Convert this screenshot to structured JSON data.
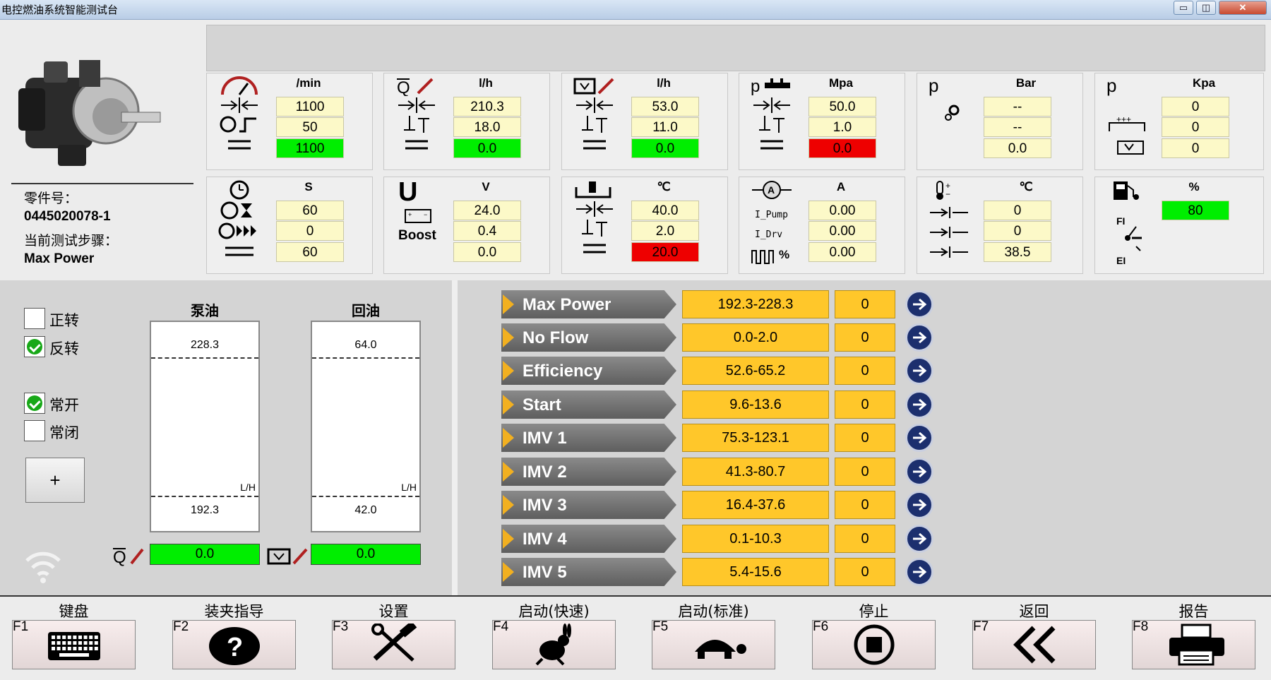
{
  "app": {
    "title": "电控燃油系统智能测试台"
  },
  "window_buttons": {
    "minimize": "▭",
    "restore": "◫",
    "close": "✕"
  },
  "cards_row1": [
    {
      "unit": "/min",
      "values": [
        "1100",
        "50",
        "1100"
      ],
      "icons": [
        "tachometer-icon",
        "setpoint-icon",
        "tolerance-icon",
        "actual-icon"
      ]
    },
    {
      "unit": "l/h",
      "values": [
        "210.3",
        "18.0",
        "0.0"
      ],
      "icons": [
        "flow-q-icon",
        "setpoint-icon",
        "tolerance-icon",
        "actual-icon"
      ]
    },
    {
      "unit": "l/h",
      "values": [
        "53.0",
        "11.0",
        "0.0"
      ],
      "icons": [
        "return-flow-icon",
        "setpoint-icon",
        "tolerance-icon",
        "actual-icon"
      ]
    },
    {
      "unit": "Mpa",
      "values": [
        "50.0",
        "1.0",
        "0.0"
      ],
      "icons": [
        "rail-pressure-icon",
        "setpoint-icon",
        "tolerance-icon",
        "actual-icon"
      ]
    },
    {
      "unit": "Bar",
      "values": [
        "--",
        "--",
        "0.0"
      ],
      "label": "p",
      "icons": [
        "gear-pressure-icon"
      ]
    },
    {
      "unit": "Kpa",
      "values": [
        "0",
        "0",
        "0"
      ],
      "label": "p",
      "icons": [
        "feed-pressure-icon",
        "return-pressure-icon"
      ]
    }
  ],
  "cards_row2": [
    {
      "unit": "S",
      "values": [
        "60",
        "0",
        "60"
      ],
      "icons": [
        "clock-icon",
        "hourglass-clock-icon",
        "fast-clock-icon",
        "total-icon"
      ]
    },
    {
      "unit": "V",
      "values": [
        "24.0",
        "0.4",
        "0.0"
      ],
      "label": "U",
      "sub": "Boost",
      "icons": [
        "battery-icon"
      ]
    },
    {
      "unit": "℃",
      "values": [
        "40.0",
        "2.0",
        "20.0"
      ],
      "icons": [
        "oil-temp-icon",
        "setpoint-icon",
        "tolerance-icon",
        "actual-icon"
      ]
    },
    {
      "unit": "A",
      "values": [
        "0.00",
        "0.00",
        "0.00"
      ],
      "labels": [
        "I_Pump",
        "I_Drv",
        "%"
      ],
      "icons": [
        "ammeter-icon",
        "pwm-icon"
      ]
    },
    {
      "unit": "℃",
      "values": [
        "0",
        "0",
        "38.5"
      ],
      "icons": [
        "thermometer-icon"
      ]
    },
    {
      "unit": "%",
      "values": [
        "80"
      ],
      "labels": [
        "FI",
        "EI"
      ],
      "icons": [
        "fuel-pump-icon",
        "switch-icon"
      ]
    }
  ],
  "part": {
    "label": "零件号：",
    "number": "0445020078-1",
    "step_label": "当前测试步骤：",
    "step": "Max Power"
  },
  "rotation": {
    "forward": "正转",
    "reverse": "反转",
    "forward_checked": false,
    "reverse_checked": true
  },
  "valve": {
    "normally_open": "常开",
    "normally_closed": "常闭",
    "open_checked": true,
    "closed_checked": false
  },
  "plus_button": "+",
  "columns": {
    "pump": {
      "title": "泵油",
      "upper": "228.3",
      "lower": "192.3",
      "unit": "L/H",
      "actual": "0.0"
    },
    "return": {
      "title": "回油",
      "upper": "64.0",
      "lower": "42.0",
      "unit": "L/H",
      "actual": "0.0"
    }
  },
  "steps": [
    {
      "name": "Max Power",
      "range": "192.3-228.3",
      "count": "0"
    },
    {
      "name": "No Flow",
      "range": "0.0-2.0",
      "count": "0"
    },
    {
      "name": "Efficiency",
      "range": "52.6-65.2",
      "count": "0"
    },
    {
      "name": "Start",
      "range": "9.6-13.6",
      "count": "0"
    },
    {
      "name": "IMV 1",
      "range": "75.3-123.1",
      "count": "0"
    },
    {
      "name": "IMV 2",
      "range": "41.3-80.7",
      "count": "0"
    },
    {
      "name": "IMV 3",
      "range": "16.4-37.6",
      "count": "0"
    },
    {
      "name": "IMV 4",
      "range": "0.1-10.3",
      "count": "0"
    },
    {
      "name": "IMV 5",
      "range": "5.4-15.6",
      "count": "0"
    }
  ],
  "fkeys": [
    {
      "key": "F1",
      "name": "键盘",
      "icon": "keyboard-icon"
    },
    {
      "key": "F2",
      "name": "装夹指导",
      "icon": "help-icon"
    },
    {
      "key": "F3",
      "name": "设置",
      "icon": "tools-icon"
    },
    {
      "key": "F4",
      "name": "启动(快速)",
      "icon": "rabbit-icon"
    },
    {
      "key": "F5",
      "name": "启动(标准)",
      "icon": "turtle-icon"
    },
    {
      "key": "F6",
      "name": "停止",
      "icon": "stop-icon"
    },
    {
      "key": "F7",
      "name": "返回",
      "icon": "back-icon"
    },
    {
      "key": "F8",
      "name": "报告",
      "icon": "printer-icon"
    }
  ],
  "colors": {
    "yellow_value": "#fcf9c8",
    "green": "#00ee00",
    "red": "#ee0000",
    "orange": "#ffc72a",
    "step_gray": "#6e6e6e",
    "go_blue": "#1c2f6e"
  }
}
